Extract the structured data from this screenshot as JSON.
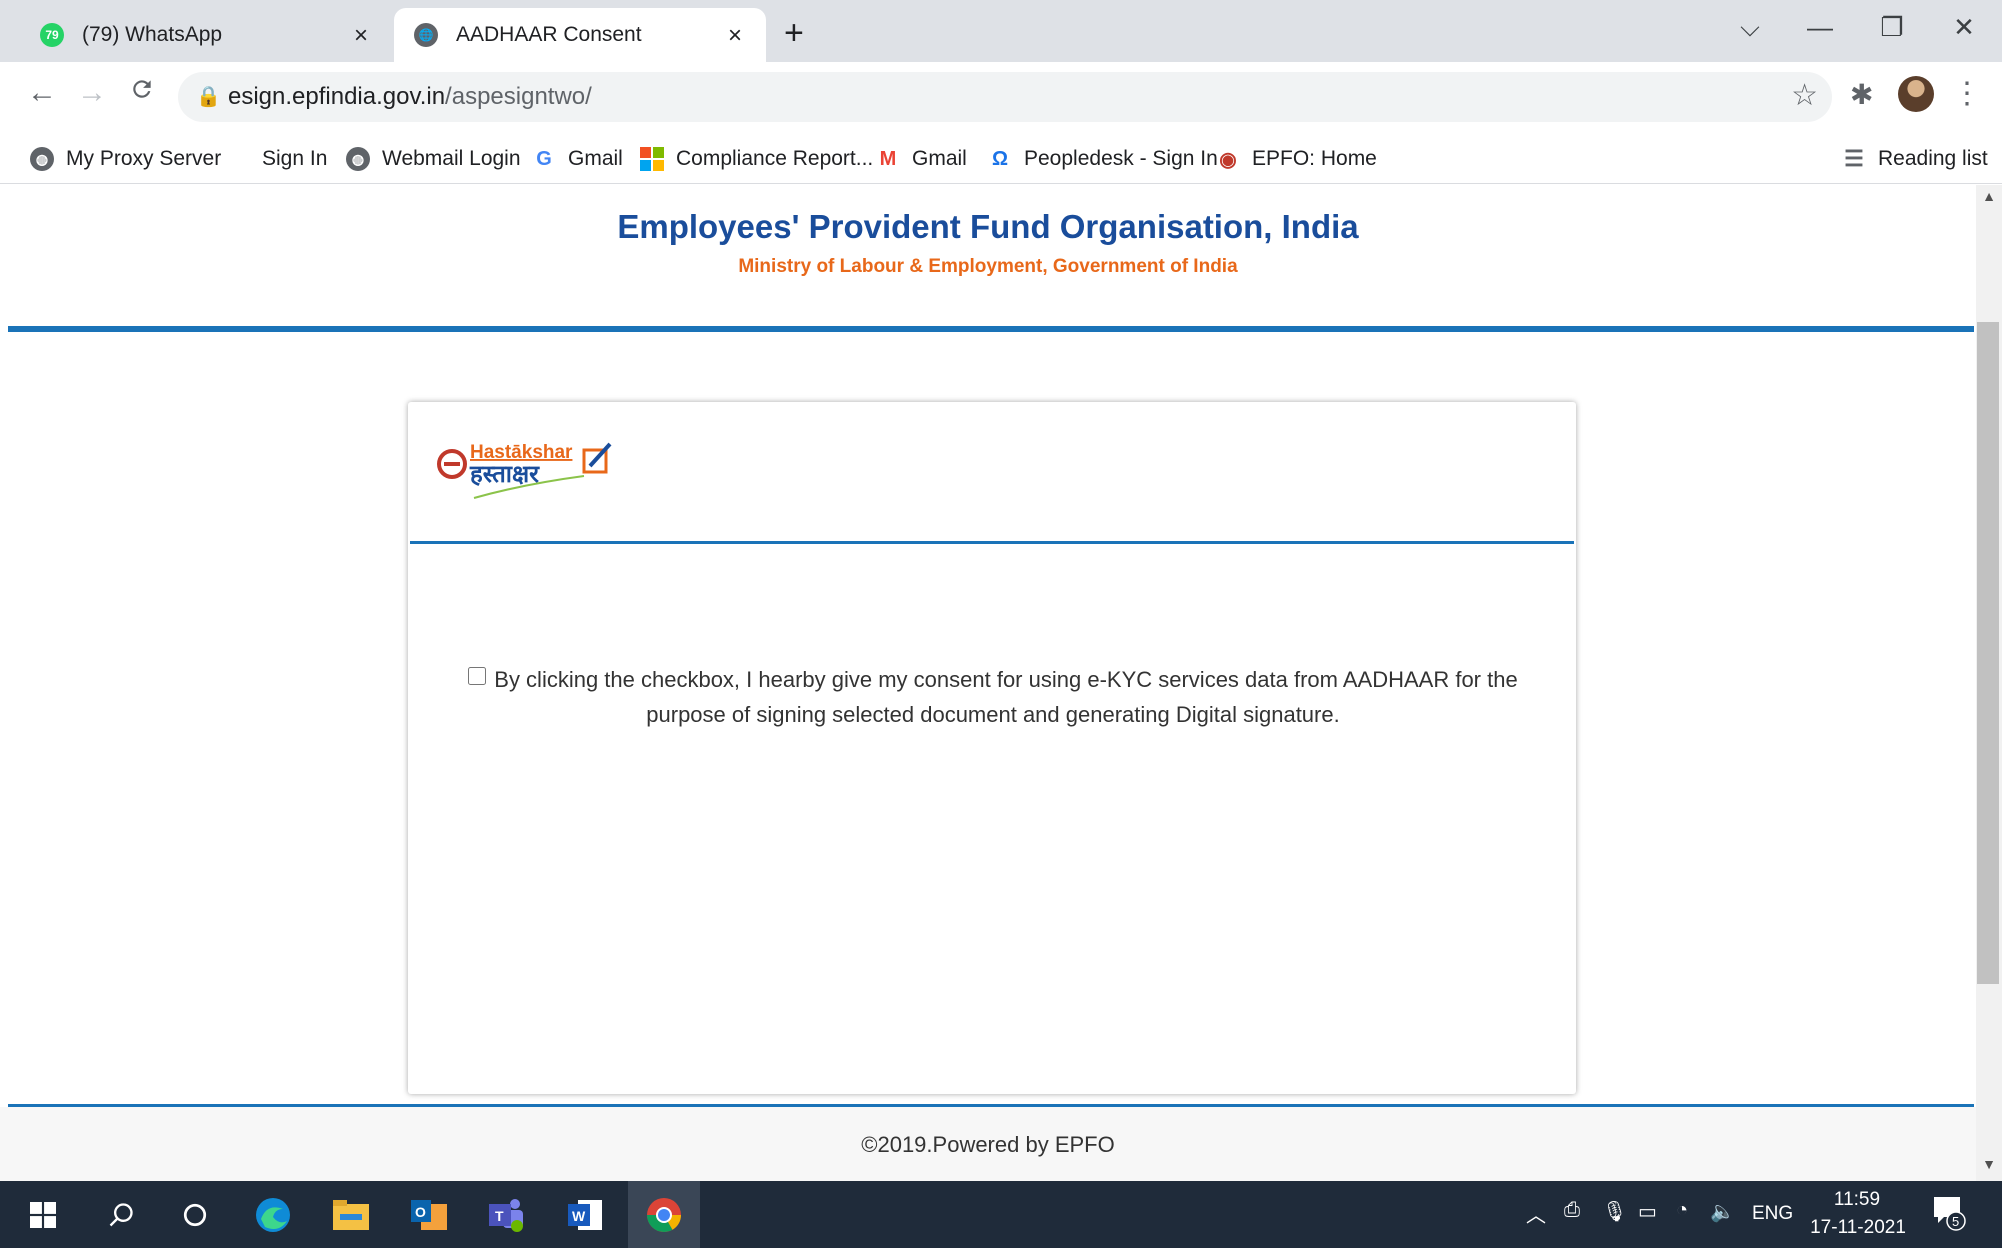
{
  "browser": {
    "tabs": [
      {
        "title": "(79) WhatsApp",
        "badge": "79",
        "close": "×"
      },
      {
        "title": "AADHAAR Consent",
        "close": "×"
      }
    ],
    "new_tab": "+",
    "window_controls": {
      "dropdown": "⌵",
      "minimize": "—",
      "restore": "❐",
      "close": "✕"
    },
    "nav": {
      "back": "←",
      "forward": "→",
      "reload": "C"
    },
    "url_host": "esign.epfindia.gov.in",
    "url_path": "/aspesigntwo/",
    "bookmarks": [
      {
        "label": "My Proxy Server",
        "icon": "globe-icon"
      },
      {
        "label": "Sign In",
        "icon": ""
      },
      {
        "label": "Webmail Login",
        "icon": "globe-icon"
      },
      {
        "label": "Gmail",
        "icon": "google-icon",
        "glyph": "G"
      },
      {
        "label": "Compliance Report...",
        "icon": "microsoft-icon"
      },
      {
        "label": "Gmail",
        "icon": "gmail-icon",
        "glyph": "M"
      },
      {
        "label": "Peopledesk - Sign In",
        "icon": "peopledesk-icon",
        "glyph": "Ω"
      },
      {
        "label": "EPFO: Home",
        "icon": "epfo-icon",
        "glyph": "◉"
      }
    ],
    "reading_list": "Reading list"
  },
  "page": {
    "org_title": "Employees' Provident Fund Organisation, India",
    "org_subtitle": "Ministry of Labour & Employment, Government of India",
    "logo": {
      "latin": "Hastākshar",
      "devanagari": "हस्ताक्षर"
    },
    "consent_text": "By clicking the checkbox, I hearby give my consent for using e-KYC services data from AADHAAR for the purpose of signing selected document and generating Digital signature.",
    "footer": "©2019.Powered by EPFO"
  },
  "taskbar": {
    "tray_lang": "ENG",
    "time": "11:59",
    "date": "17-11-2021",
    "notifications": "5"
  },
  "colors": {
    "title_blue": "#1a4d9b",
    "subtitle_orange": "#e8681a",
    "rule_blue": "#1a73b8"
  }
}
